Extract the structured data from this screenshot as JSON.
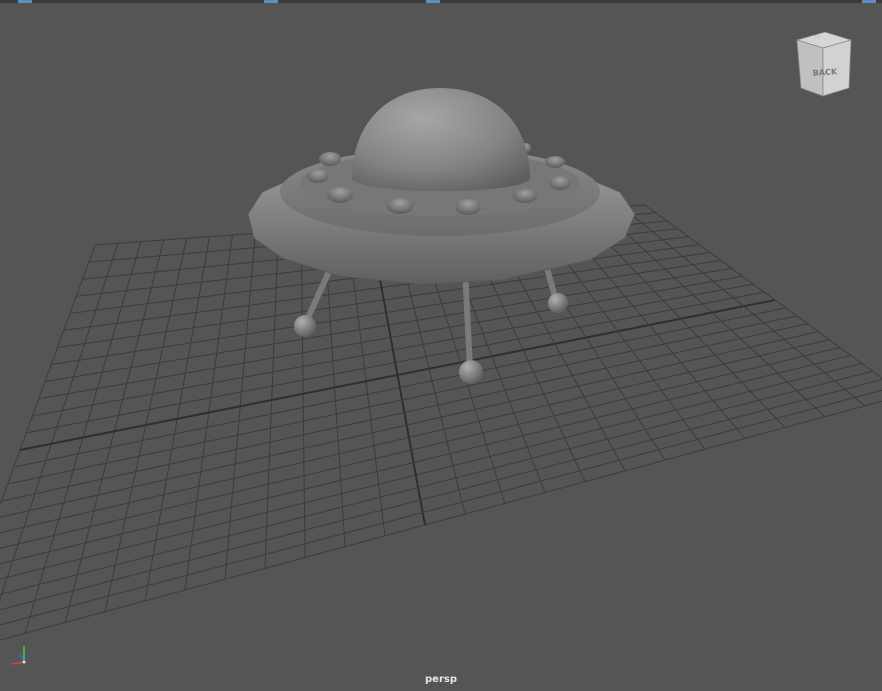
{
  "viewport": {
    "camera_name": "persp",
    "background_color": "#555555",
    "grid_color": "#3c3c3c",
    "grid_axis_color": "#2f2f2f",
    "model_color": "#8c8c8c"
  },
  "viewcube": {
    "face_label": "BACK"
  },
  "axis_gizmo": {
    "x_color": "#e04040",
    "y_color": "#40d040",
    "z_color": "#4060ff"
  }
}
